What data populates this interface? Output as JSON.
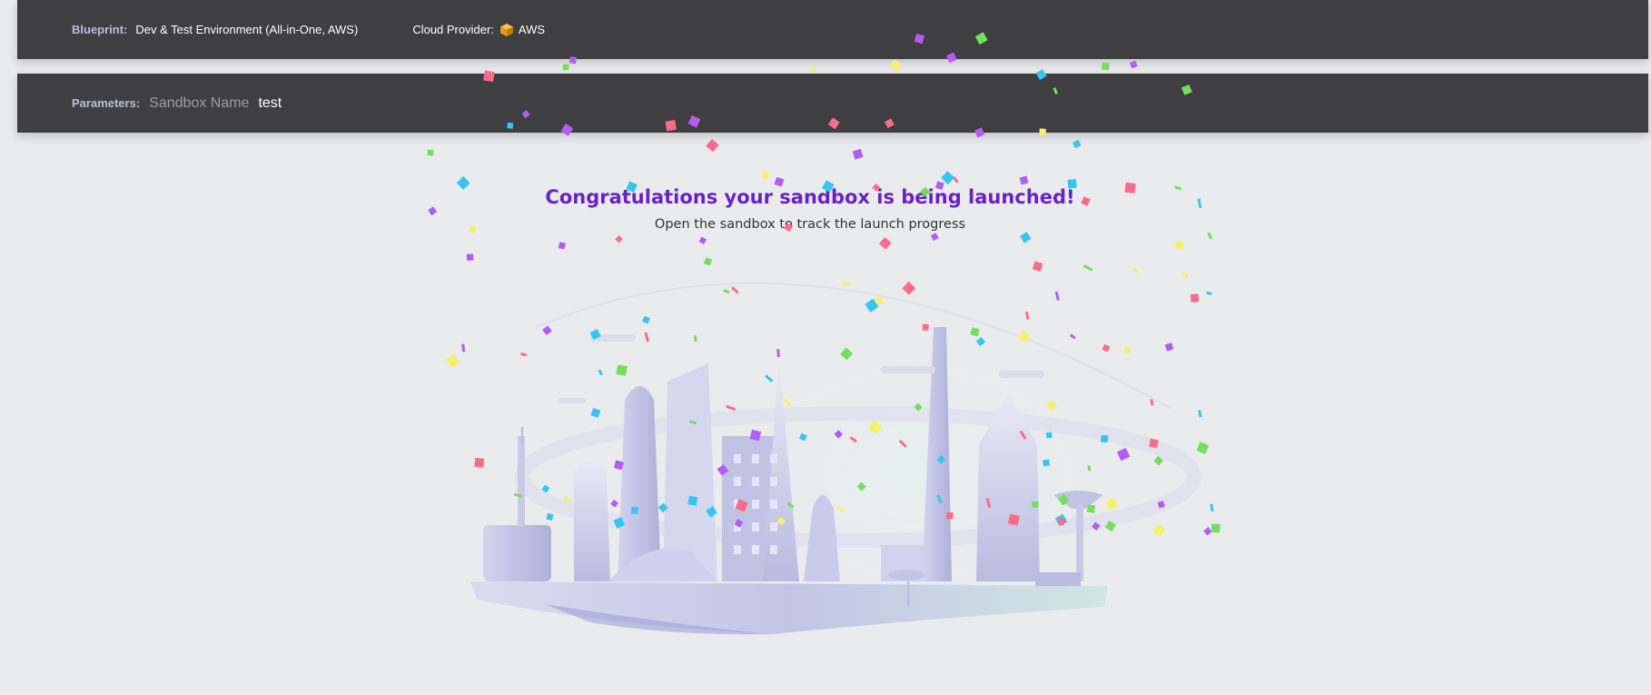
{
  "header": {
    "blueprint_label": "Blueprint:",
    "blueprint_value": "Dev & Test Environment (All-in-One, AWS)",
    "provider_label": "Cloud Provider:",
    "provider_value": "AWS",
    "provider_icon": "aws-box-icon"
  },
  "parameters": {
    "label": "Parameters:",
    "param_name": "Sandbox Name",
    "param_value": "test"
  },
  "message": {
    "title": "Congratulations your sandbox is being launched!",
    "subtitle": "Open the sandbox to track the launch progress"
  },
  "colors": {
    "accent": "#6a22c8",
    "bar": "#3f3f42",
    "confetti": [
      "#ff6b8b",
      "#35c7f2",
      "#b45cf5",
      "#f4f26a",
      "#72e05a"
    ]
  }
}
